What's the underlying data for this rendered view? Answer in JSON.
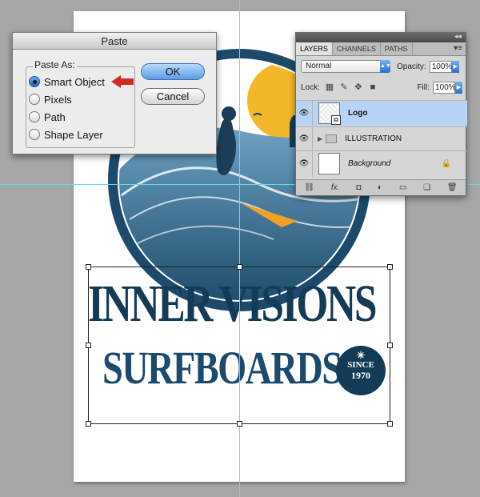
{
  "paste_dialog": {
    "title": "Paste",
    "group_label": "Paste As:",
    "options": [
      "Smart Object",
      "Pixels",
      "Path",
      "Shape Layer"
    ],
    "selected": "Smart Object",
    "ok_label": "OK",
    "cancel_label": "Cancel"
  },
  "layers_panel": {
    "tabs": [
      "LAYERS",
      "CHANNELS",
      "PATHS"
    ],
    "active_tab": "LAYERS",
    "blend_mode": "Normal",
    "opacity_label": "Opacity:",
    "opacity_value": "100%",
    "lock_label": "Lock:",
    "fill_label": "Fill:",
    "fill_value": "100%",
    "layers": [
      {
        "name": "Logo",
        "selected": true
      },
      {
        "name": "ILLUSTRATION",
        "selected": false
      },
      {
        "name": "Background",
        "selected": false
      }
    ]
  },
  "artwork": {
    "line1": "INNER VISIONS",
    "line2": "SURFBOARDS",
    "badge_since": "SINCE",
    "badge_year": "1970"
  },
  "colors": {
    "accent_blue": "#2d6fcd",
    "logo_navy": "#143b55",
    "sun_yellow": "#f2b829",
    "guide_cyan": "#5ce0e6",
    "arrow_red": "#d42a27"
  }
}
